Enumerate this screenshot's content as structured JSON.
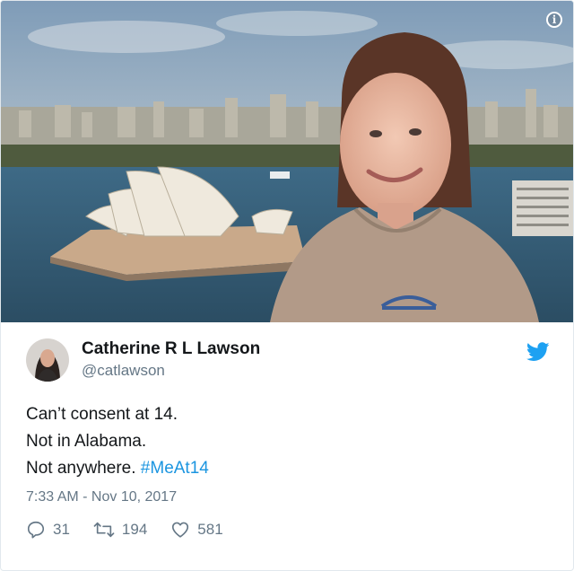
{
  "photo": {
    "alt": "",
    "info_icon": "info-icon"
  },
  "author": {
    "display_name": "Catherine R L Lawson",
    "handle": "@catlawson",
    "avatar": "avatar",
    "brand_icon": "twitter-bird-icon"
  },
  "tweet": {
    "lines": [
      "Can’t consent at 14.",
      "Not in Alabama.",
      "Not anywhere."
    ],
    "hashtag": "#MeAt14",
    "timestamp": "7:33 AM - Nov 10, 2017"
  },
  "actions": {
    "replies": "31",
    "retweets": "194",
    "likes": "581"
  },
  "colors": {
    "link": "#1b95e0",
    "muted": "#657786",
    "text": "#14171a",
    "twitter_blue": "#1da1f2"
  }
}
